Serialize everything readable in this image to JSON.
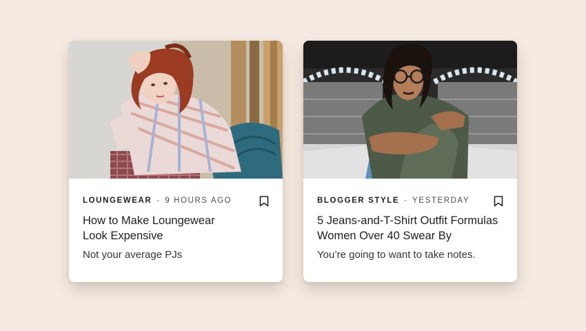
{
  "cards": [
    {
      "category": "Loungewear",
      "separator": "-",
      "time": "9 hours ago",
      "title": "How to Make Loungewear Look Expensive",
      "subtitle": "Not your average PJs",
      "bookmark_icon": "bookmark-icon",
      "image": "photo of a red-haired woman in a plaid shirt sitting on a blue chair"
    },
    {
      "category": "Blogger Style",
      "separator": "-",
      "time": "Yesterday",
      "title": "5 Jeans-and-T-Shirt Outfit Formulas Women Over 40 Swear By",
      "subtitle": "You’re going to want to take notes.",
      "bookmark_icon": "bookmark-icon",
      "image": "photo of a woman with glasses in a green t-shirt crouching on a lit bridge"
    }
  ],
  "colors": {
    "background": "#f5ebe2",
    "card": "#ffffff",
    "text": "#1e1e1e"
  }
}
